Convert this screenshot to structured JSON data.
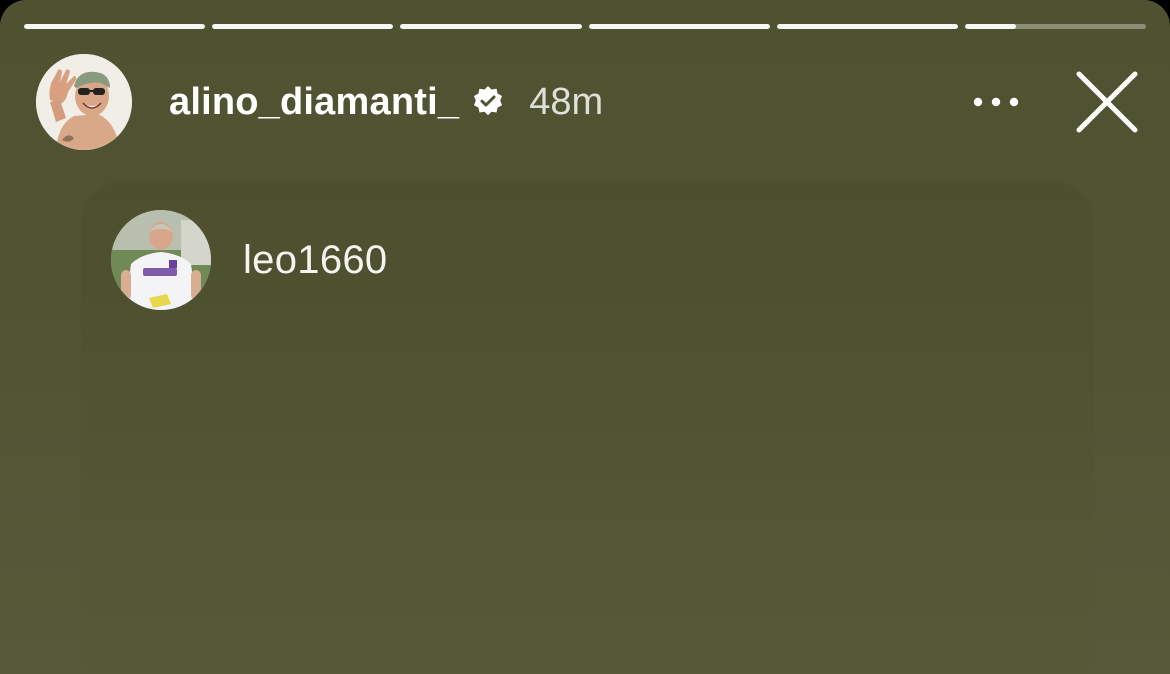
{
  "story": {
    "progress_segments": [
      1,
      1,
      1,
      1,
      1,
      0.28
    ],
    "author": {
      "username": "alino_diamanti_",
      "verified": true,
      "posted_ago": "48m"
    },
    "header_icons": {
      "verified": "verified-badge-icon",
      "more": "more-options-icon",
      "close": "close-icon"
    },
    "shared_post": {
      "username": "leo1660"
    }
  },
  "colors": {
    "background": "#515433",
    "card": "#4f5231",
    "text": "#ffffff"
  }
}
